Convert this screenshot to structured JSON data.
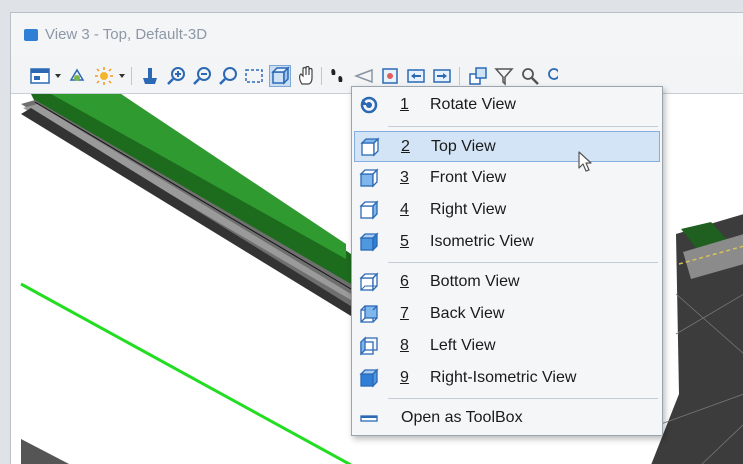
{
  "window": {
    "title": "View 3 - Top, Default-3D"
  },
  "toolbar": {
    "buttons": [
      {
        "name": "view-attributes-icon"
      },
      {
        "name": "view-display-icon"
      },
      {
        "name": "lighting-icon"
      },
      {
        "name": "update-view-icon"
      },
      {
        "name": "zoom-in-icon"
      },
      {
        "name": "zoom-out-icon"
      },
      {
        "name": "window-area-icon"
      },
      {
        "name": "fit-view-icon"
      },
      {
        "name": "rotate-view-icon"
      },
      {
        "name": "pan-view-icon"
      },
      {
        "name": "walk-icon"
      },
      {
        "name": "view-previous-icon"
      },
      {
        "name": "view-next-icon"
      },
      {
        "name": "copy-view-icon"
      },
      {
        "name": "clip-volume-icon"
      },
      {
        "name": "clip-mask-icon"
      }
    ]
  },
  "menu": {
    "items": [
      {
        "num": "1",
        "label": "Rotate View",
        "icon": "rotate-view-icon"
      },
      {
        "num": "2",
        "label": "Top View",
        "icon": "cube-top-icon",
        "hover": true
      },
      {
        "num": "3",
        "label": "Front View",
        "icon": "cube-front-icon"
      },
      {
        "num": "4",
        "label": "Right View",
        "icon": "cube-right-icon"
      },
      {
        "num": "5",
        "label": "Isometric View",
        "icon": "cube-iso-icon"
      },
      {
        "num": "6",
        "label": "Bottom View",
        "icon": "cube-bottom-icon"
      },
      {
        "num": "7",
        "label": "Back View",
        "icon": "cube-back-icon"
      },
      {
        "num": "8",
        "label": "Left View",
        "icon": "cube-left-icon"
      },
      {
        "num": "9",
        "label": "Right-Isometric View",
        "icon": "cube-right-iso-icon"
      }
    ],
    "toolbox_label": "Open as ToolBox"
  },
  "colors": {
    "accent": "#2c69b5",
    "hover_bg": "#d3e4f6",
    "line_green": "#22dd22"
  }
}
